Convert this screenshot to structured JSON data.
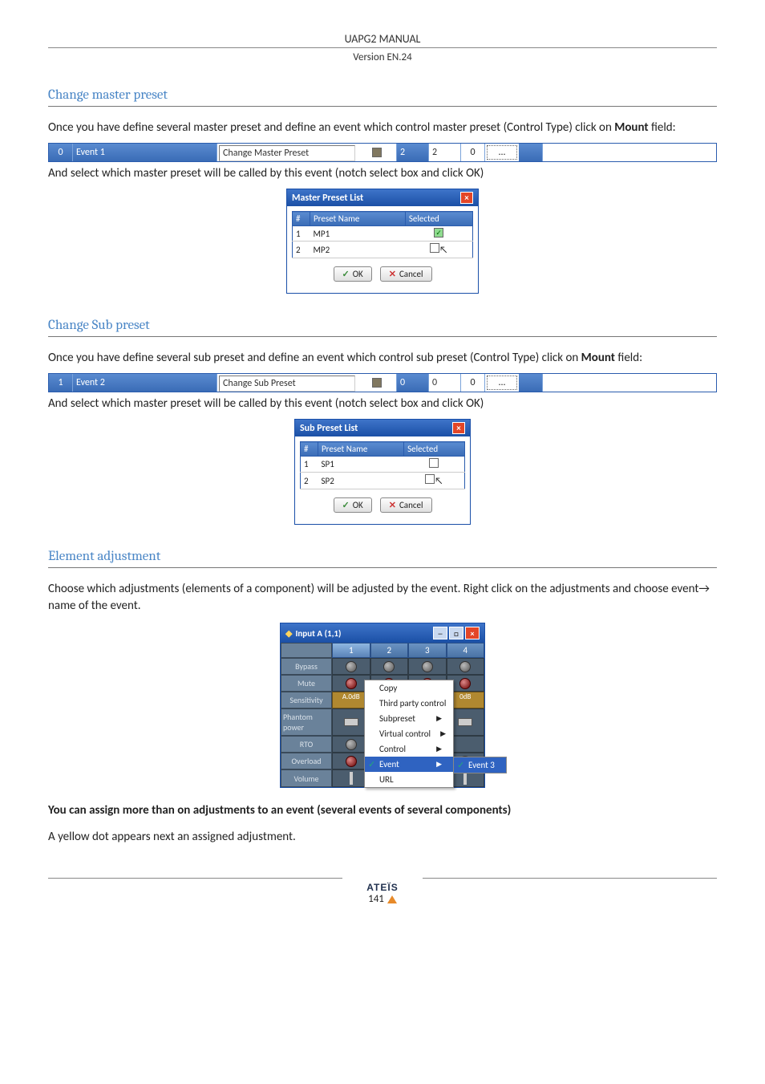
{
  "header": {
    "title": "UAPG2  MANUAL",
    "version": "Version EN.24"
  },
  "sections": {
    "s1": {
      "heading": "Change master preset",
      "intro_a": "Once you have define several master preset and define an event which control master preset (Control Type) click on ",
      "intro_b": "Mount",
      "intro_c": " field:",
      "event_row": {
        "no": "0",
        "name": "Event 1",
        "type": "Change Master Preset",
        "v1": "2",
        "v2": "2",
        "v3": "0",
        "more": "..."
      },
      "line2": "And select which master preset will be called by this event (notch select box and click OK)",
      "dialog": {
        "title": "Master Preset List",
        "headers": {
          "num": "#",
          "name": "Preset Name",
          "selected": "Selected"
        },
        "rows": [
          {
            "num": "1",
            "name": "MP1",
            "selected": true
          },
          {
            "num": "2",
            "name": "MP2",
            "selected": false
          }
        ],
        "ok": "OK",
        "cancel": "Cancel"
      }
    },
    "s2": {
      "heading": "Change Sub preset",
      "intro_a": "Once you have define several sub preset and define an event which control sub preset (Control Type) click on ",
      "intro_b": "Mount",
      "intro_c": " field:",
      "event_row": {
        "no": "1",
        "name": "Event 2",
        "type": "Change Sub Preset",
        "v1": "0",
        "v2": "0",
        "v3": "0",
        "more": "..."
      },
      "line2": "And select which master preset will be called by this event (notch select box and click OK)",
      "dialog": {
        "title": "Sub Preset List",
        "headers": {
          "num": "#",
          "name": "Preset Name",
          "selected": "Selected"
        },
        "rows": [
          {
            "num": "1",
            "name": "SP1",
            "selected": false
          },
          {
            "num": "2",
            "name": "SP2",
            "selected": false
          }
        ],
        "ok": "OK",
        "cancel": "Cancel"
      }
    },
    "s3": {
      "heading": "Element adjustment",
      "intro": "Choose which adjustments (elements of a component) will be adjusted by the event. Right click on the adjustments and choose event→ name of the event.",
      "window": {
        "title": "Input A (1,1)",
        "tabs": [
          "1",
          "2",
          "3",
          "4"
        ],
        "rows": [
          "Bypass",
          "Mute",
          "Sensitivity",
          "Phantom power",
          "RTO",
          "Overload",
          "Volume"
        ],
        "sens_val": "A.0dB",
        "menu": {
          "items": [
            "Copy",
            "Third party control",
            "Subpreset",
            "Virtual control",
            "Control",
            "Event",
            "URL"
          ],
          "highlighted": "Event",
          "sub": "Event 3"
        }
      },
      "note": "You can assign more than on adjustments to an event (several events of several components)",
      "tail": "A yellow dot appears next an assigned adjustment."
    }
  },
  "footer": {
    "logo": "ATEÏS",
    "page": "141"
  }
}
